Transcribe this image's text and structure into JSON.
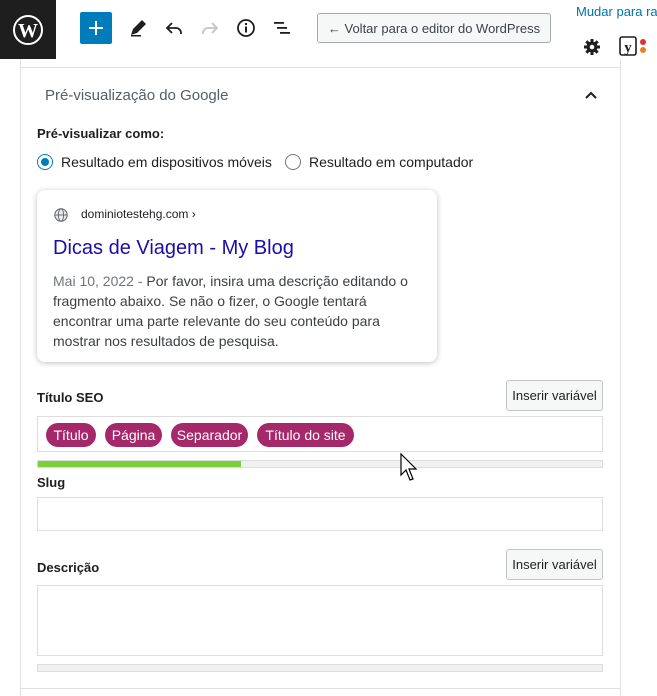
{
  "toolbar": {
    "logo_icon": "wordpress-icon",
    "add_icon": "plus-icon",
    "tools_icon": "pencil-icon",
    "undo_icon": "undo-icon",
    "redo_icon": "redo-icon",
    "info_icon": "info-icon",
    "outline_icon": "list-view-icon",
    "back_label": "← Voltar para o editor do WordPress",
    "switch_label": "Mudar para ra",
    "settings_icon": "gear-icon",
    "yoast_icon": "yoast-icon",
    "accent": "#007cba"
  },
  "panel": {
    "title": "Pré-visualização do Google",
    "preview_as_label": "Pré-visualizar como:",
    "options": [
      {
        "label": "Resultado em dispositivos móveis",
        "checked": true
      },
      {
        "label": "Resultado em computador",
        "checked": false
      }
    ]
  },
  "snippet": {
    "url": "dominiotestehg.com ›",
    "title": "Dicas de Viagem - My Blog",
    "date": "Mai 10, 2022",
    "separator": " - ",
    "description": "Por favor, insira uma descrição editando o fragmento abaixo. Se não o fizer, o Google tentará encontrar uma parte relevante do seu conteúdo para mostrar nos resultados de pesquisa.",
    "title_color": "#1a0dab"
  },
  "seo_title": {
    "label": "Título SEO",
    "insert_button": "Inserir variável",
    "tags": [
      "Título",
      "Página",
      "Separador",
      "Título do site"
    ],
    "tag_color": "#a4286a",
    "progress": 0.36,
    "progress_color": "#7ad03a"
  },
  "slug": {
    "label": "Slug",
    "value": ""
  },
  "description": {
    "label": "Descrição",
    "insert_button": "Inserir variável",
    "value": "",
    "progress": 0
  }
}
